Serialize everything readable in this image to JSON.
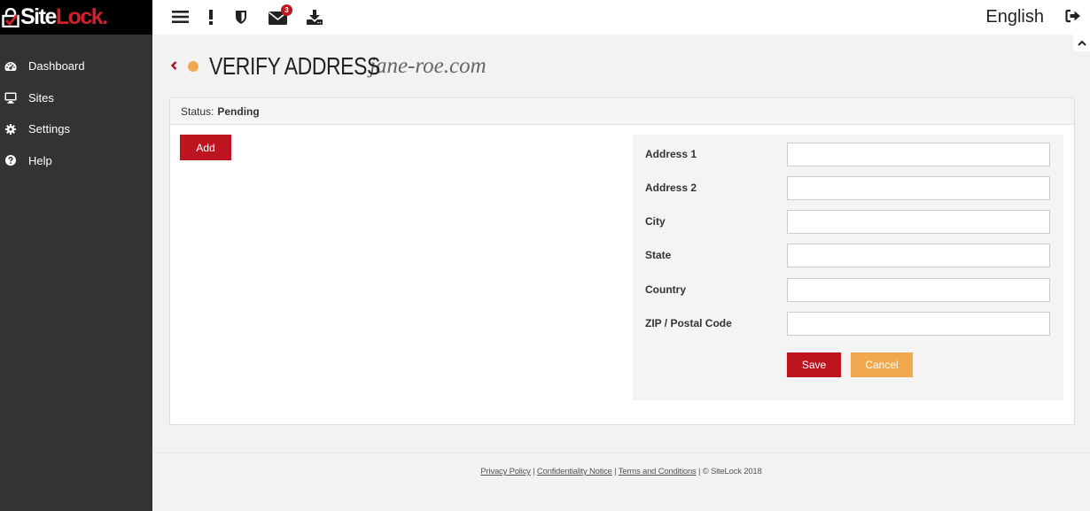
{
  "brand": {
    "logo_site": "Site",
    "logo_lock": "Lock",
    "logo_dot": ".",
    "colors": {
      "primary_red": "#be1420",
      "accent_orange": "#f0a94f",
      "sidebar_bg": "#333333",
      "logo_bg": "#000000"
    }
  },
  "sidebar": {
    "items": [
      {
        "label": "Dashboard",
        "icon": "dashboard-gauge-icon"
      },
      {
        "label": "Sites",
        "icon": "monitor-icon"
      },
      {
        "label": "Settings",
        "icon": "gear-icon"
      },
      {
        "label": "Help",
        "icon": "question-circle-icon"
      }
    ]
  },
  "topbar": {
    "icons": [
      "menu-icon",
      "alert-icon",
      "shield-icon",
      "envelope-icon",
      "download-icon"
    ],
    "notification_count": "3",
    "language": "English",
    "logout_icon": "sign-out-icon"
  },
  "page": {
    "back_icon": "chevron-left-icon",
    "status_color": "#f0a94f",
    "title": "VERIFY ADDRESS",
    "domain": "jane-roe.com"
  },
  "panel": {
    "status_label": "Status:",
    "status_value": "Pending",
    "add_button": "Add"
  },
  "form": {
    "fields": [
      {
        "label": "Address 1",
        "value": "",
        "placeholder": ""
      },
      {
        "label": "Address 2",
        "value": "",
        "placeholder": ""
      },
      {
        "label": "City",
        "value": "",
        "placeholder": ""
      },
      {
        "label": "State",
        "value": "",
        "placeholder": ""
      },
      {
        "label": "Country",
        "value": "",
        "placeholder": ""
      },
      {
        "label": "ZIP / Postal Code",
        "value": "",
        "placeholder": ""
      }
    ],
    "save_button": "Save",
    "cancel_button": "Cancel"
  },
  "footer": {
    "links": [
      "Privacy Policy",
      "Confidentiality Notice",
      "Terms and Conditions"
    ],
    "separator": " | ",
    "copyright": "© SiteLock 2018"
  }
}
